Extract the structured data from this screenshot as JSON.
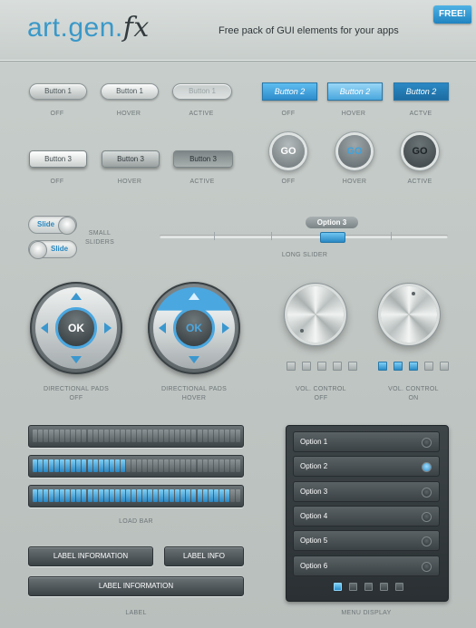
{
  "header": {
    "logo_main": "art.gen.",
    "logo_fx": "fx",
    "tagline": "Free pack of GUI elements for your apps",
    "badge": "FREE!"
  },
  "row1": {
    "button1": {
      "label": "Button 1",
      "states": [
        "OFF",
        "HOVER",
        "ACTIVE"
      ]
    },
    "button2": {
      "label": "Button 2",
      "states": [
        "OFF",
        "HOVER",
        "ACTVE"
      ]
    }
  },
  "row2": {
    "button3": {
      "label": "Button 3",
      "states": [
        "OFF",
        "HOVER",
        "ACTIVE"
      ]
    },
    "go": {
      "label": "GO",
      "states": [
        "OFF",
        "HOVER",
        "ACTIVE"
      ]
    }
  },
  "sliders": {
    "small_label": "Slide",
    "small_caption": "SMALL SLIDERS",
    "long_value": "Option 3",
    "long_caption": "LONG SLIDER"
  },
  "dpads": {
    "ok": "OK",
    "captions": [
      "DIRECTIONAL PADS\nOFF",
      "DIRECTIONAL PADS\nHOVER"
    ]
  },
  "volume": {
    "captions": [
      "VOL. CONTROL\nOFF",
      "VOL. CONTROL\nON"
    ],
    "levels": [
      0,
      3
    ],
    "steps": 5
  },
  "loadbar": {
    "caption": "LOAD BAR",
    "fills": [
      0,
      0.45,
      0.95
    ]
  },
  "labels": {
    "wide": "LABEL INFORMATION",
    "short": "LABEL INFO",
    "full": "LABEL INFORMATION",
    "caption": "LABEL"
  },
  "menu": {
    "items": [
      "Option 1",
      "Option 2",
      "Option 3",
      "Option 4",
      "Option 5",
      "Option 6"
    ],
    "selected_index": 1,
    "page": 1,
    "pages": 5,
    "caption": "MENU DISPLAY"
  },
  "colors": {
    "accent": "#2d8ccb",
    "logo": "#3a98c8"
  }
}
